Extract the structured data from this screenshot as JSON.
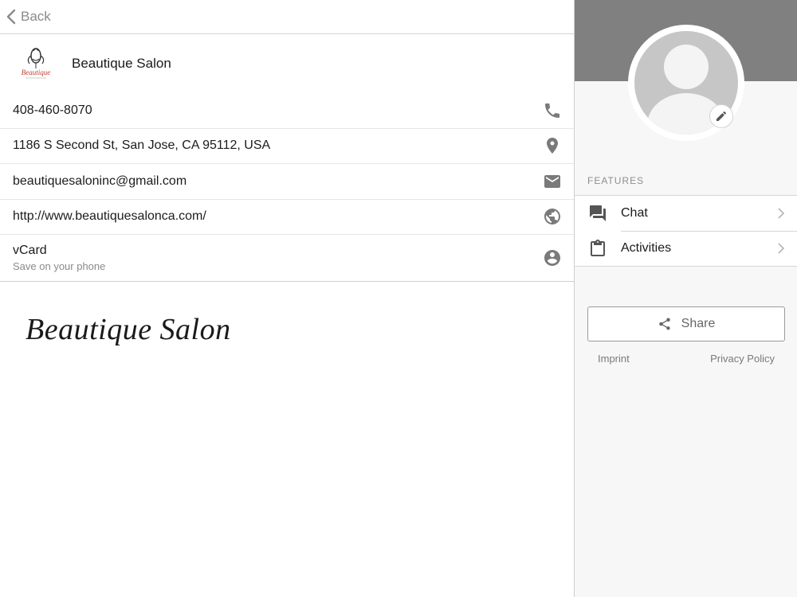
{
  "nav": {
    "back_label": "Back"
  },
  "business": {
    "name": "Beautique Salon",
    "logo_text": "Beautique",
    "signature": "Beautique Salon"
  },
  "contacts": [
    {
      "text": "408-460-8070",
      "icon": "phone-icon"
    },
    {
      "text": "1186 S Second St, San Jose, CA 95112, USA",
      "icon": "location-pin-icon"
    },
    {
      "text": "beautiquesaloninc@gmail.com",
      "icon": "mail-icon"
    },
    {
      "text": "http://www.beautiquesalonca.com/",
      "icon": "globe-icon"
    },
    {
      "text": "vCard",
      "subtext": "Save on your phone",
      "icon": "account-icon"
    }
  ],
  "sidebar": {
    "features_label": "FEATURES",
    "features": [
      {
        "label": "Chat",
        "icon": "chat-icon"
      },
      {
        "label": "Activities",
        "icon": "clipboard-icon"
      }
    ],
    "share_label": "Share",
    "imprint_label": "Imprint",
    "privacy_label": "Privacy Policy"
  },
  "colors": {
    "cover": "#808080",
    "avatar_bg": "#c6c6c6",
    "icon": "#7a7a7a"
  }
}
